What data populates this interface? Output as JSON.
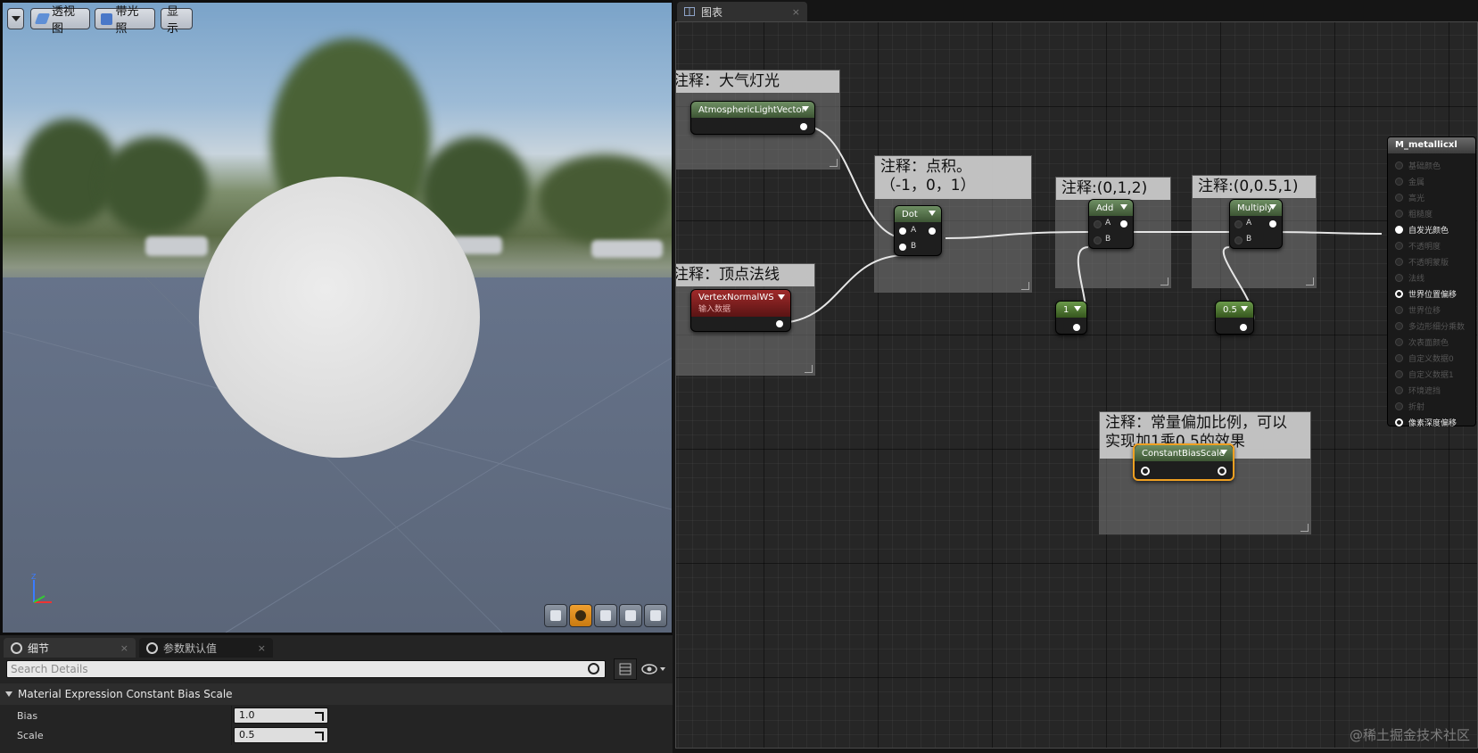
{
  "viewport": {
    "toolbar": {
      "menu_label": "",
      "perspective_label": "透视图",
      "lit_label": "带光照",
      "show_label": "显示"
    },
    "preview_shapes": [
      "cylinder",
      "sphere",
      "plane",
      "cube",
      "custom-mesh"
    ]
  },
  "details": {
    "tabs": [
      {
        "label": "细节",
        "active": true
      },
      {
        "label": "参数默认值",
        "active": false
      }
    ],
    "search_placeholder": "Search Details",
    "category": "Material Expression Constant Bias Scale",
    "properties": [
      {
        "name": "Bias",
        "value": "1.0"
      },
      {
        "name": "Scale",
        "value": "0.5"
      }
    ]
  },
  "graph": {
    "tab_label": "图表",
    "comments": {
      "atmos": "注释：大气灯光",
      "vertex": "注释：顶点法线",
      "dot": "注释：点积。\n（-1，0，1）",
      "add": "注释:(0,1,2)",
      "mult": "注释:(0,0.5,1)",
      "bias": "注释：常量偏加比例，可以\n实现加1乘0.5的效果"
    },
    "nodes": {
      "atmos": "AtmosphericLightVector",
      "vertex": "VertexNormalWS",
      "vertex_sub": "输入数据",
      "dot": "Dot",
      "add": "Add",
      "multiply": "Multiply",
      "const1": "1",
      "const05": "0.5",
      "bias": "ConstantBiasScale",
      "pin_a": "A",
      "pin_b": "B"
    },
    "result": {
      "title": "M_metallicxl",
      "inputs": [
        {
          "label": "基础颜色",
          "state": "off"
        },
        {
          "label": "金属",
          "state": "off"
        },
        {
          "label": "高光",
          "state": "off"
        },
        {
          "label": "粗糙度",
          "state": "off"
        },
        {
          "label": "自发光颜色",
          "state": "on"
        },
        {
          "label": "不透明度",
          "state": "off"
        },
        {
          "label": "不透明蒙版",
          "state": "off"
        },
        {
          "label": "法线",
          "state": "off"
        },
        {
          "label": "世界位置偏移",
          "state": "hl"
        },
        {
          "label": "世界位移",
          "state": "off"
        },
        {
          "label": "多边形细分乘数",
          "state": "off"
        },
        {
          "label": "次表面颜色",
          "state": "off"
        },
        {
          "label": "自定义数据0",
          "state": "off"
        },
        {
          "label": "自定义数据1",
          "state": "off"
        },
        {
          "label": "环境遮挡",
          "state": "off"
        },
        {
          "label": "折射",
          "state": "off"
        },
        {
          "label": "像素深度偏移",
          "state": "hl"
        }
      ]
    }
  },
  "watermark": "@稀土掘金技术社区",
  "colors": {
    "accent_orange": "#f0a021",
    "node_header_green": "#4d6b43",
    "node_header_red": "#8a1f1f"
  }
}
